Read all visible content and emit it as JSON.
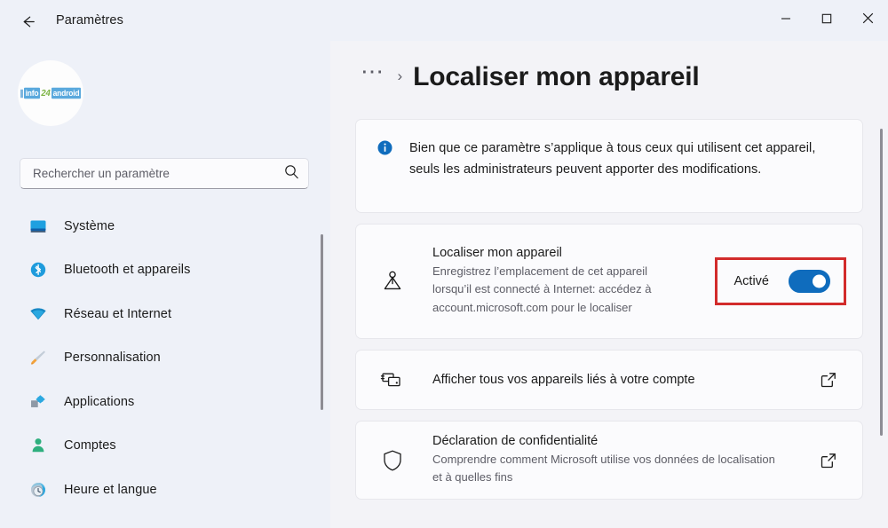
{
  "window": {
    "app_title": "Paramètres",
    "back_icon": "back-arrow-icon",
    "minimize_label": "–",
    "maximize_label": "□",
    "close_label": "✕"
  },
  "sidebar": {
    "avatar": {
      "watermark_prefix": "info",
      "watermark_number": "24",
      "watermark_suffix": "android"
    },
    "search": {
      "placeholder": "Rechercher un paramètre",
      "value": "",
      "icon": "search-icon"
    },
    "items": [
      {
        "label": "Système",
        "icon": "monitor-icon"
      },
      {
        "label": "Bluetooth et appareils",
        "icon": "bluetooth-icon"
      },
      {
        "label": "Réseau et Internet",
        "icon": "wifi-icon"
      },
      {
        "label": "Personnalisation",
        "icon": "paintbrush-icon"
      },
      {
        "label": "Applications",
        "icon": "apps-icon"
      },
      {
        "label": "Comptes",
        "icon": "person-icon"
      },
      {
        "label": "Heure et langue",
        "icon": "clock-globe-icon"
      }
    ]
  },
  "main": {
    "breadcrumb": {
      "ellipsis": "⋯",
      "separator": "›",
      "title": "Localiser mon appareil"
    },
    "info_banner": {
      "icon": "info-circle-icon",
      "text": "Bien que ce paramètre s’applique à tous ceux qui utilisent cet appareil, seuls les administrateurs peuvent apporter des modifications."
    },
    "find_device": {
      "icon": "location-person-icon",
      "title": "Localiser mon appareil",
      "description": "Enregistrez l’emplacement de cet appareil lorsqu’il est connecté à Internet: accédez à account.microsoft.com pour le localiser",
      "toggle_label": "Activé",
      "toggle_state": "on",
      "toggle_color": "#0f6cbd",
      "highlight_color": "#d22b2b"
    },
    "devices_link": {
      "icon": "devices-icon",
      "title": "Afficher tous vos appareils liés à votre compte",
      "external_icon": "external-link-icon"
    },
    "privacy_link": {
      "icon": "shield-icon",
      "title": "Déclaration de confidentialité",
      "description": "Comprendre comment Microsoft utilise vos données de localisation et à quelles fins",
      "external_icon": "external-link-icon"
    }
  }
}
